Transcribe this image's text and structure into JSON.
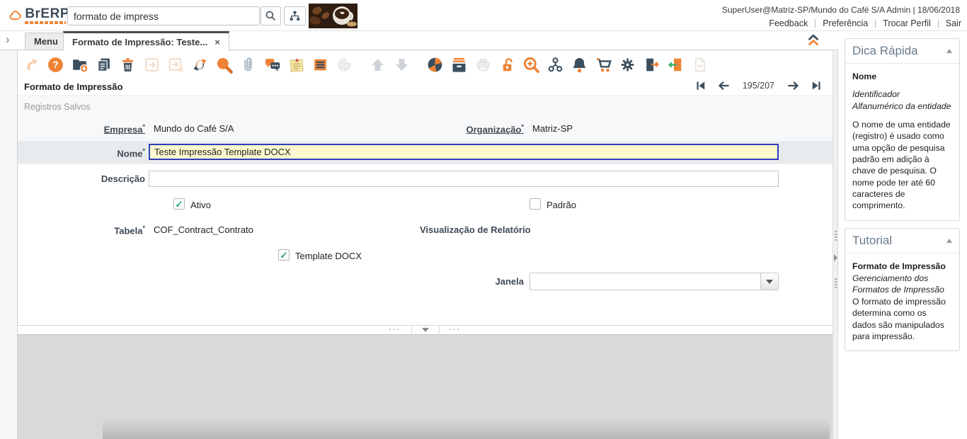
{
  "misc": {
    "required": "*",
    "close": "×",
    "west_arrow": "›",
    "grip": "···"
  },
  "header": {
    "brand": "BrERP",
    "search": {
      "value": "formato de impress"
    },
    "user_info": "SuperUser@Matriz-SP/Mundo do Café S/A Admin | 18/06/2018",
    "menu": {
      "feedback": "Feedback",
      "preferencia": "Preferência",
      "trocar_perfil": "Trocar Perfil",
      "sair": "Sair"
    }
  },
  "tabs": {
    "menu": "Menu",
    "active": "Formato de Impressão: Teste..."
  },
  "toolbar": {
    "icons": [
      "undo",
      "help",
      "new-record",
      "copy-record",
      "delete-record",
      "save",
      "save-and-new",
      "requery",
      "find",
      "attachment",
      "chat",
      "note",
      "toggle-grid",
      "customize",
      "parent-record",
      "detail-record",
      "chart",
      "archive",
      "print",
      "lock",
      "zoom-across",
      "workflow",
      "notifications",
      "requisition",
      "process",
      "export",
      "sign-out",
      "file"
    ]
  },
  "record_nav": {
    "position": "195/207"
  },
  "form": {
    "title": "Formato de Impressão",
    "status": "Registros Salvos",
    "fields": {
      "empresa": {
        "label": "Empresa",
        "value": "Mundo do Café S/A"
      },
      "organizacao": {
        "label": "Organização",
        "value": "Matriz-SP"
      },
      "nome": {
        "label": "Nome",
        "value": "Teste Impressão Template DOCX"
      },
      "descricao": {
        "label": "Descrição",
        "value": ""
      },
      "ativo": {
        "label": "Ativo",
        "mark": "✓"
      },
      "padrao": {
        "label": "Padrão",
        "mark": ""
      },
      "tabela": {
        "label": "Tabela",
        "value": "COF_Contract_Contrato"
      },
      "visualizacao": {
        "label": "Visualização de Relatório"
      },
      "template_docx": {
        "label": "Template DOCX",
        "mark": "✓"
      },
      "janela": {
        "label": "Janela",
        "value": ""
      }
    }
  },
  "sidebar": {
    "dica": {
      "title": "Dica Rápida",
      "field": "Nome",
      "subtitle": "Identificador Alfanumérico da entidade",
      "body": "O nome de uma entidade (registro) é usado como uma opção de pesquisa padrão em adição à chave de pesquisa. O nome pode ter até 60 caracteres de comprimento."
    },
    "tutorial": {
      "title": "Tutorial",
      "heading": "Formato de Impressão",
      "subtitle": "Gerenciamento dos Formatos de Impressão",
      "body": "O formato de impressão determina como os dados são manipulados para impressão."
    }
  }
}
